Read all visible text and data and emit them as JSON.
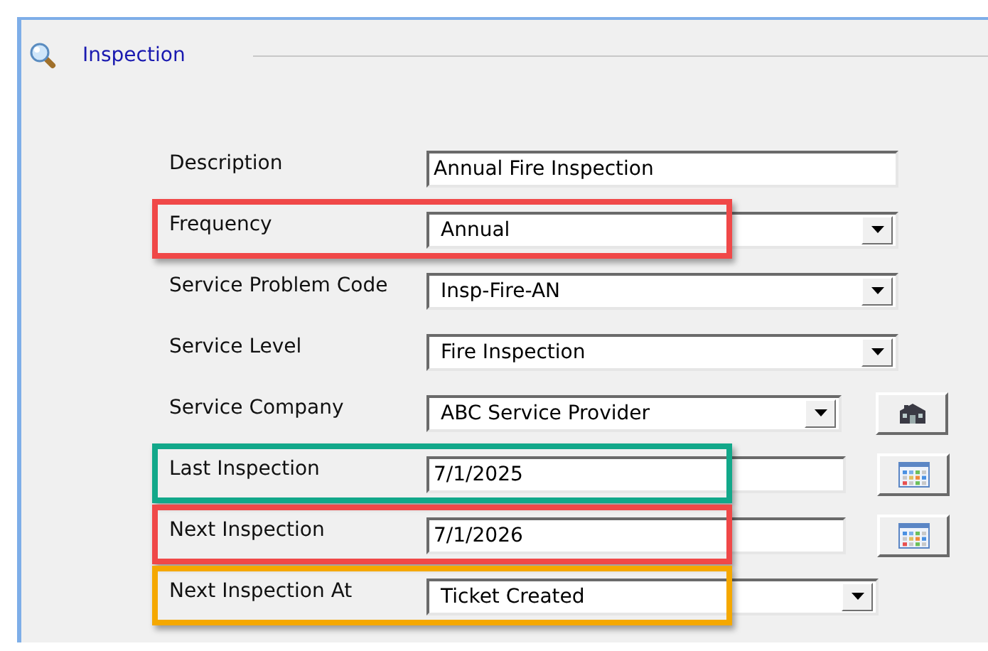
{
  "section": {
    "title": "Inspection"
  },
  "fields": [
    {
      "label": "Description",
      "kind": "text",
      "value": "Annual Fire Inspection"
    },
    {
      "label": "Frequency",
      "kind": "dropdown",
      "value": "Annual",
      "color": "#f04848"
    },
    {
      "label": "Service Problem Code",
      "kind": "dropdown",
      "value": "Insp-Fire-AN"
    },
    {
      "label": "Service Level",
      "kind": "dropdown",
      "value": "Fire Inspection"
    },
    {
      "label": "Service Company",
      "kind": "dropdown",
      "value": "ABC Service Provider",
      "button": {
        "kind": "lookup"
      }
    },
    {
      "label": "Last Inspection",
      "kind": "date",
      "value": "7/1/2025",
      "button": {
        "kind": "calendar"
      },
      "color": "#12a88a"
    },
    {
      "label": "Next Inspection",
      "kind": "date",
      "value": "7/1/2026",
      "button": {
        "kind": "calendar"
      },
      "color": "#f04848"
    },
    {
      "label": "Next Inspection At",
      "kind": "dropdown",
      "value": "Ticket Created",
      "color": "#f5a800"
    }
  ]
}
